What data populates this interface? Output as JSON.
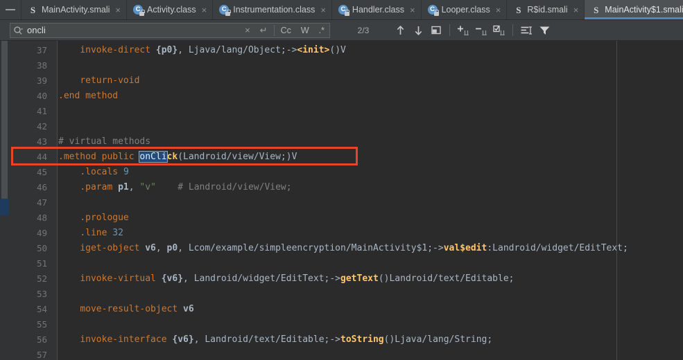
{
  "tabbar": {
    "scroll_left_icon": "scroll-left-icon",
    "tabs": [
      {
        "label": "MainActivity.smali",
        "icon": "smali-file-icon",
        "icon_glyph": "S",
        "active": false,
        "close": "×"
      },
      {
        "label": "Activity.class",
        "icon": "class-file-icon",
        "icon_glyph": "C",
        "active": false,
        "close": "×"
      },
      {
        "label": "Instrumentation.class",
        "icon": "class-file-icon",
        "icon_glyph": "C",
        "active": false,
        "close": "×"
      },
      {
        "label": "Handler.class",
        "icon": "class-file-icon",
        "icon_glyph": "C",
        "active": false,
        "close": "×"
      },
      {
        "label": "Looper.class",
        "icon": "class-file-icon",
        "icon_glyph": "C",
        "active": false,
        "close": "×"
      },
      {
        "label": "R$id.smali",
        "icon": "smali-file-icon",
        "icon_glyph": "S",
        "active": false,
        "close": "×"
      },
      {
        "label": "MainActivity$1.smali",
        "icon": "smali-file-icon",
        "icon_glyph": "S",
        "active": true,
        "close": "×"
      }
    ]
  },
  "search": {
    "query": "oncli",
    "placeholder": "Search",
    "search_icon": "search-dropdown-icon",
    "clear_label": "×",
    "history_label": "↵",
    "options": [
      {
        "key": "case",
        "label": "Cc",
        "name": "match-case-toggle"
      },
      {
        "key": "words",
        "label": "W",
        "name": "words-toggle"
      },
      {
        "key": "regex",
        "label": ".*",
        "name": "regex-toggle"
      }
    ],
    "counter": "2/3",
    "buttons": [
      {
        "name": "find-previous-button",
        "icon": "arrow-up-icon"
      },
      {
        "name": "find-next-button",
        "icon": "arrow-down-icon"
      },
      {
        "name": "open-in-find-window-button",
        "icon": "panel-icon"
      },
      {
        "name": "add-selection-button",
        "icon": "add-selection-icon"
      },
      {
        "name": "remove-selection-button",
        "icon": "remove-selection-icon"
      },
      {
        "name": "select-all-occurrences-button",
        "icon": "select-all-icon"
      },
      {
        "name": "preserve-case-button",
        "icon": "indent-list-icon"
      },
      {
        "name": "filter-button",
        "icon": "filter-funnel-icon"
      }
    ]
  },
  "editor": {
    "first_line": 37,
    "highlight_line": 44,
    "margin_guide_x": 889,
    "lines": [
      {
        "num": 37,
        "tokens": [
          {
            "t": "    ",
            "c": "t-plain"
          },
          {
            "t": "invoke-direct ",
            "c": "t-kw"
          },
          {
            "t": "{p0}",
            "c": "t-reg"
          },
          {
            "t": ", ",
            "c": "t-plain"
          },
          {
            "t": "Ljava/lang/Object;->",
            "c": "t-plain"
          },
          {
            "t": "<init>",
            "c": "t-bold"
          },
          {
            "t": "()V",
            "c": "t-plain"
          }
        ]
      },
      {
        "num": 38,
        "tokens": []
      },
      {
        "num": 39,
        "tokens": [
          {
            "t": "    ",
            "c": "t-plain"
          },
          {
            "t": "return-void",
            "c": "t-kw"
          }
        ]
      },
      {
        "num": 40,
        "tokens": [
          {
            "t": ".end method",
            "c": "t-kw"
          }
        ]
      },
      {
        "num": 41,
        "tokens": []
      },
      {
        "num": 42,
        "tokens": []
      },
      {
        "num": 43,
        "tokens": [
          {
            "t": "# virtual methods",
            "c": "t-cmt"
          }
        ]
      },
      {
        "num": 44,
        "tokens": [
          {
            "t": ".method public ",
            "c": "t-kw"
          },
          {
            "t": "onCli",
            "c": "match"
          },
          {
            "t": "ck",
            "c": "t-bold"
          },
          {
            "t": "(Landroid/view/View;)V",
            "c": "t-plain"
          }
        ]
      },
      {
        "num": 45,
        "tokens": [
          {
            "t": "    ",
            "c": "t-plain"
          },
          {
            "t": ".locals ",
            "c": "t-kw"
          },
          {
            "t": "9",
            "c": "t-num"
          }
        ]
      },
      {
        "num": 46,
        "tokens": [
          {
            "t": "    ",
            "c": "t-plain"
          },
          {
            "t": ".param ",
            "c": "t-kw"
          },
          {
            "t": "p1",
            "c": "t-reg"
          },
          {
            "t": ", ",
            "c": "t-plain"
          },
          {
            "t": "\"v\"",
            "c": "t-str"
          },
          {
            "t": "    # Landroid/view/View;",
            "c": "t-cmt"
          }
        ]
      },
      {
        "num": 47,
        "tokens": []
      },
      {
        "num": 48,
        "tokens": [
          {
            "t": "    ",
            "c": "t-plain"
          },
          {
            "t": ".prologue",
            "c": "t-kw"
          }
        ]
      },
      {
        "num": 49,
        "tokens": [
          {
            "t": "    ",
            "c": "t-plain"
          },
          {
            "t": ".line ",
            "c": "t-kw"
          },
          {
            "t": "32",
            "c": "t-num"
          }
        ]
      },
      {
        "num": 50,
        "tokens": [
          {
            "t": "    ",
            "c": "t-plain"
          },
          {
            "t": "iget-object ",
            "c": "t-kw"
          },
          {
            "t": "v6",
            "c": "t-reg"
          },
          {
            "t": ", ",
            "c": "t-plain"
          },
          {
            "t": "p0",
            "c": "t-reg"
          },
          {
            "t": ", ",
            "c": "t-plain"
          },
          {
            "t": "Lcom/example/simpleencryption/MainActivity$1;->",
            "c": "t-plain"
          },
          {
            "t": "val$edit",
            "c": "t-bold"
          },
          {
            "t": ":Landroid/widget/EditText;",
            "c": "t-plain"
          }
        ]
      },
      {
        "num": 51,
        "tokens": []
      },
      {
        "num": 52,
        "tokens": [
          {
            "t": "    ",
            "c": "t-plain"
          },
          {
            "t": "invoke-virtual ",
            "c": "t-kw"
          },
          {
            "t": "{v6}",
            "c": "t-reg"
          },
          {
            "t": ", ",
            "c": "t-plain"
          },
          {
            "t": "Landroid/widget/EditText;->",
            "c": "t-plain"
          },
          {
            "t": "getText",
            "c": "t-bold"
          },
          {
            "t": "()Landroid/text/Editable;",
            "c": "t-plain"
          }
        ]
      },
      {
        "num": 53,
        "tokens": []
      },
      {
        "num": 54,
        "tokens": [
          {
            "t": "    ",
            "c": "t-plain"
          },
          {
            "t": "move-result-object ",
            "c": "t-kw"
          },
          {
            "t": "v6",
            "c": "t-reg"
          }
        ]
      },
      {
        "num": 55,
        "tokens": []
      },
      {
        "num": 56,
        "tokens": [
          {
            "t": "    ",
            "c": "t-plain"
          },
          {
            "t": "invoke-interface ",
            "c": "t-kw"
          },
          {
            "t": "{v6}",
            "c": "t-reg"
          },
          {
            "t": ", ",
            "c": "t-plain"
          },
          {
            "t": "Landroid/text/Editable;->",
            "c": "t-plain"
          },
          {
            "t": "toString",
            "c": "t-bold"
          },
          {
            "t": "()Ljava/lang/String;",
            "c": "t-plain"
          }
        ]
      },
      {
        "num": 57,
        "tokens": []
      }
    ]
  },
  "annotation": {
    "name": "red-highlight-box",
    "color": "#e8442a",
    "target_line": 44
  },
  "colors": {
    "background": "#2b2b2b",
    "chrome": "#3c3f41",
    "gutter": "#313335",
    "active_tab": "#4e5254",
    "accent": "#4a88c7",
    "match_highlight": "#1f4b7d",
    "annotation": "#e8442a",
    "keyword": "#cc7832",
    "method": "#ffc66d",
    "number": "#6897bb",
    "string": "#6a8759",
    "comment": "#808080",
    "text": "#a9b7c6"
  }
}
